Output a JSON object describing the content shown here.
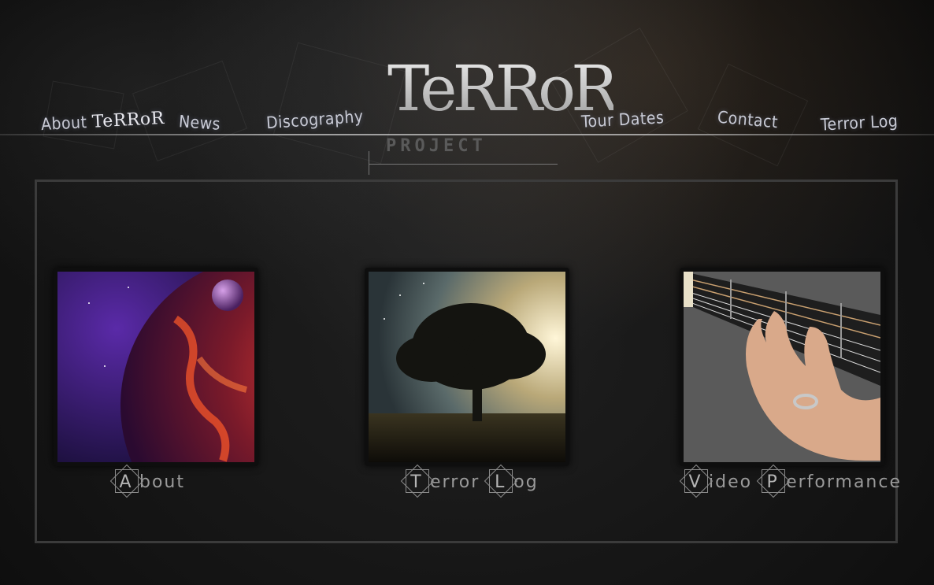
{
  "nav": {
    "items": [
      {
        "label_prefix": "About ",
        "label_brand": "TeRRoR"
      },
      {
        "label": "News"
      },
      {
        "label": "Discography"
      },
      {
        "label": "Tour Dates"
      },
      {
        "label": "Contact"
      },
      {
        "label": "Terror Log"
      }
    ]
  },
  "logo": {
    "word": "TeRRoR",
    "sub": "PROJECT"
  },
  "cards": [
    {
      "image": "planet-artwork",
      "caption_parts": [
        {
          "letter": "A",
          "rest": "bout"
        }
      ]
    },
    {
      "image": "tree-silhouette-artwork",
      "caption_parts": [
        {
          "letter": "T",
          "rest": "error "
        },
        {
          "letter": "L",
          "rest": "og"
        }
      ]
    },
    {
      "image": "guitar-hand-photo",
      "caption_parts": [
        {
          "letter": "V",
          "rest": "ideo "
        },
        {
          "letter": "P",
          "rest": "erformance"
        }
      ]
    }
  ],
  "colors": {
    "background": "#141414",
    "frame": "#3b3b3b",
    "nav_text": "#c9cbd6",
    "caption": "#9a9a9a"
  }
}
